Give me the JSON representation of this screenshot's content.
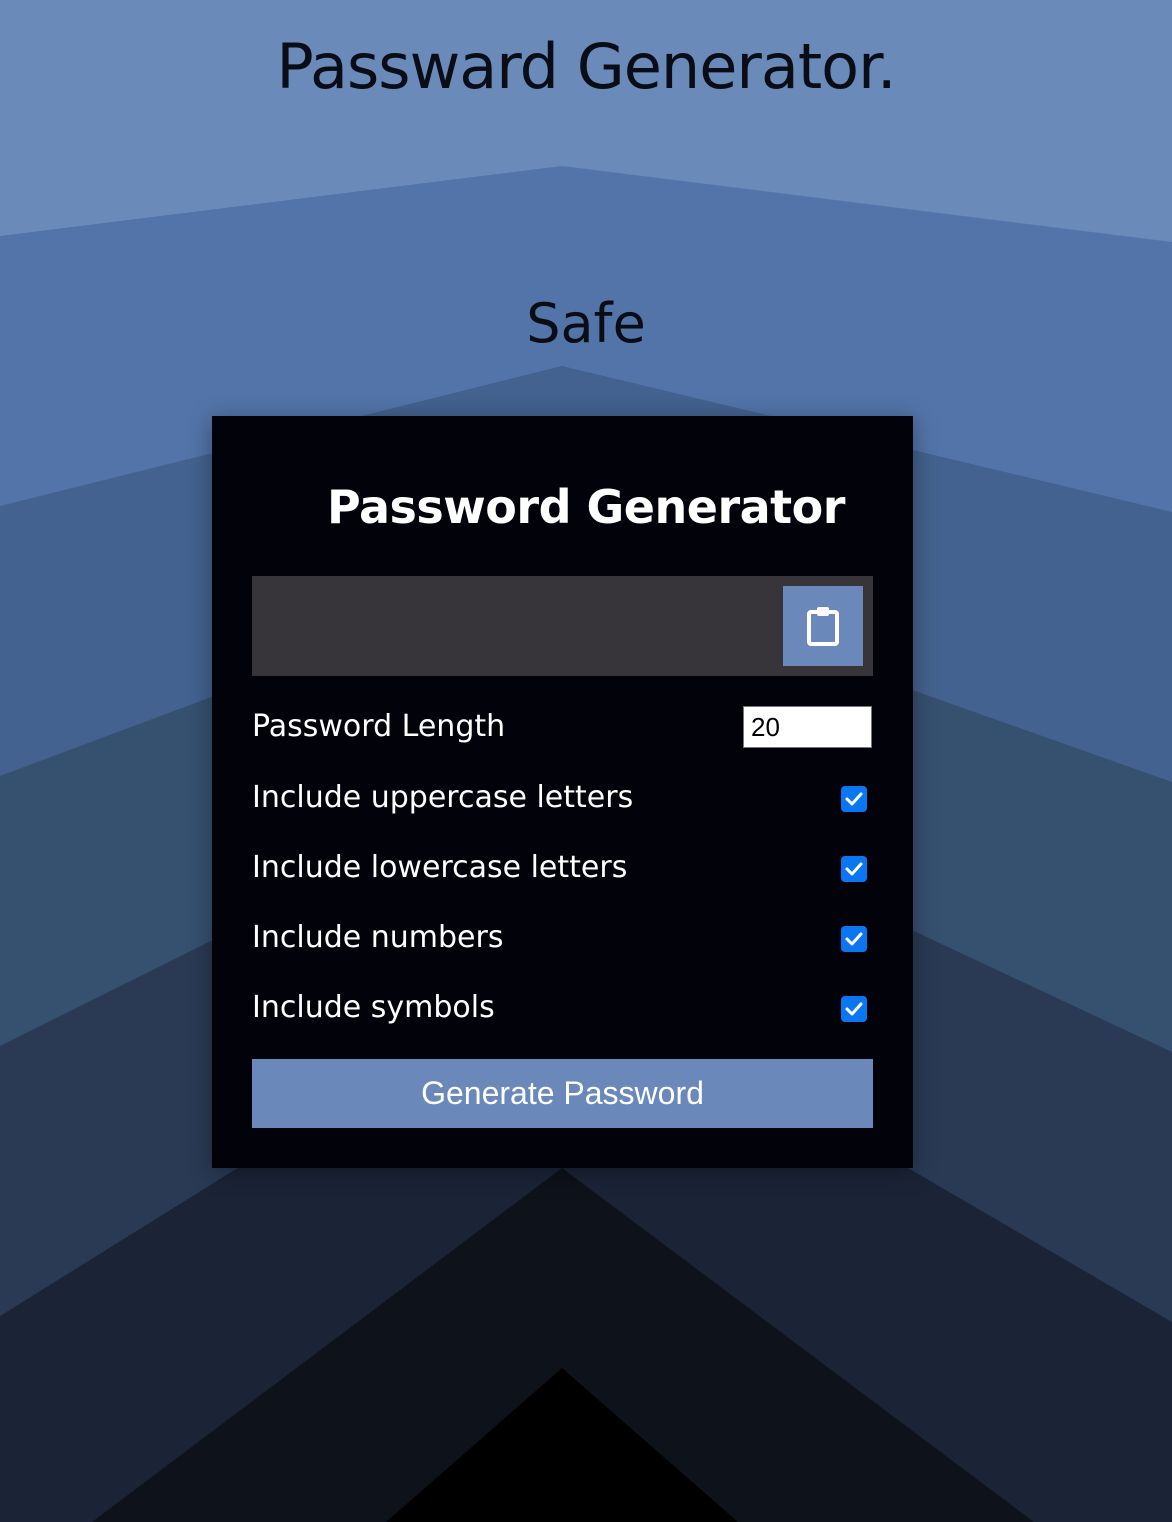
{
  "header": {
    "title": "Passward Generator.",
    "subtitle": "Safe"
  },
  "card": {
    "title": "Password Generator",
    "result": {
      "value": "",
      "copy_icon": "clipboard-icon"
    },
    "settings": {
      "length": {
        "label": "Password Length",
        "value": "20"
      },
      "uppercase": {
        "label": "Include uppercase letters",
        "checked": true
      },
      "lowercase": {
        "label": "Include lowercase letters",
        "checked": true
      },
      "numbers": {
        "label": "Include numbers",
        "checked": true
      },
      "symbols": {
        "label": "Include symbols",
        "checked": true
      }
    },
    "generate_label": "Generate Password"
  },
  "colors": {
    "background_top": "#6a8aba",
    "card_bg": "#02030a",
    "result_bg": "#38353a",
    "accent": "#6a89ba",
    "checkbox": "#0b76f2"
  }
}
